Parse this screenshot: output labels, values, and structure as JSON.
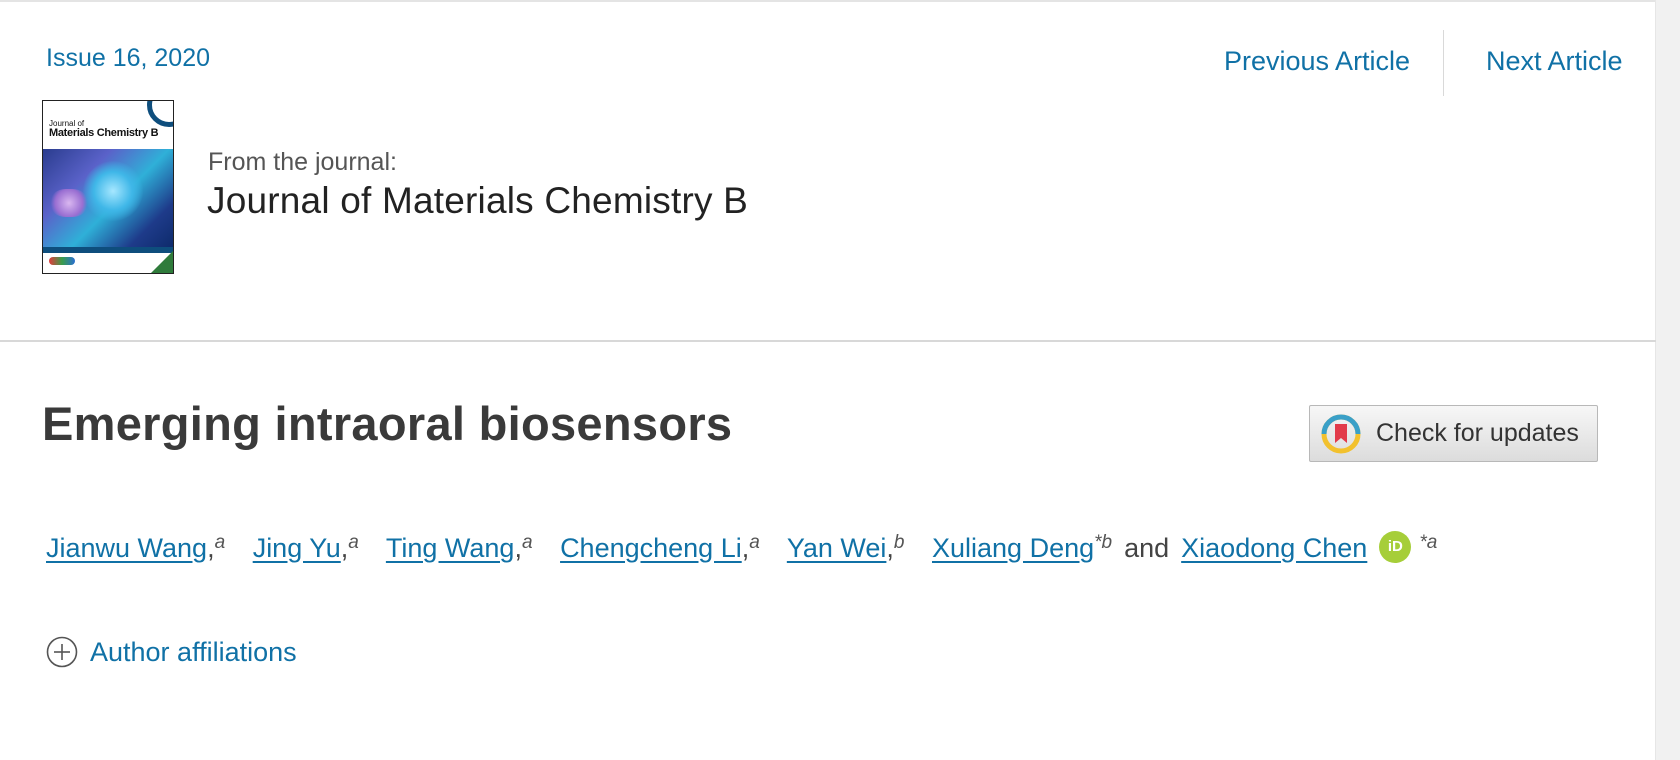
{
  "header": {
    "issue_link": "Issue 16, 2020",
    "prev_article": "Previous Article",
    "next_article": "Next Article"
  },
  "journal": {
    "from_label": "From the journal:",
    "name": "Journal of Materials Chemistry B",
    "cover": {
      "title_line1": "Journal of",
      "title_line2": "Materials Chemistry B"
    }
  },
  "article": {
    "title": "Emerging intraoral biosensors",
    "check_updates_label": "Check for updates"
  },
  "authors": [
    {
      "name": "Jianwu Wang",
      "sup": "a",
      "corresponding": false
    },
    {
      "name": "Jing Yu",
      "sup": "a",
      "corresponding": false
    },
    {
      "name": "Ting Wang",
      "sup": "a",
      "corresponding": false
    },
    {
      "name": "Chengcheng Li",
      "sup": "a",
      "corresponding": false
    },
    {
      "name": "Yan Wei",
      "sup": "b",
      "corresponding": false
    },
    {
      "name": "Xuliang Deng",
      "sup": "*b",
      "corresponding": true
    },
    {
      "name": "Xiaodong Chen",
      "sup": "*a",
      "corresponding": true,
      "orcid": true
    }
  ],
  "authors_conjunction": "and",
  "orcid_badge": "iD",
  "comma": ",",
  "affiliations_label": "Author affiliations",
  "colors": {
    "link": "#1071a6",
    "title": "#3a3a3a",
    "orcid": "#a6ce39"
  },
  "icons": [
    "crossmark-icon",
    "orcid-icon",
    "plus-circle-icon"
  ]
}
